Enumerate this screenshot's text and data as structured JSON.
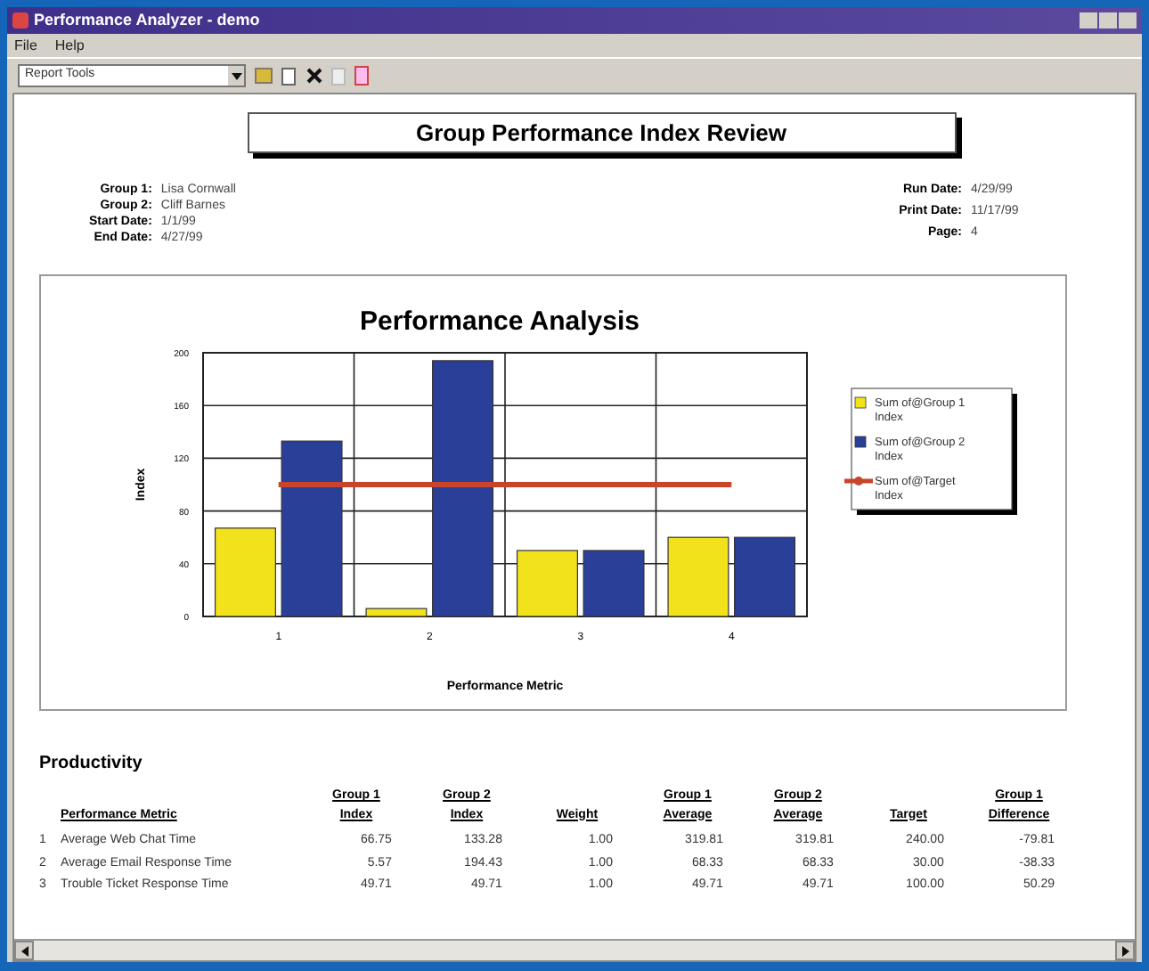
{
  "window": {
    "title": "Performance Analyzer - demo"
  },
  "menu": [
    "File",
    "Help"
  ],
  "toolbar": {
    "report_select": "Report Tools"
  },
  "report": {
    "title": "Group Performance Index Review",
    "info_left": [
      {
        "label": "Group 1:",
        "value": "Lisa Cornwall"
      },
      {
        "label": "Group 2:",
        "value": "Cliff Barnes"
      },
      {
        "label": "Start Date:",
        "value": "1/1/99"
      },
      {
        "label": "End Date:",
        "value": "4/27/99"
      }
    ],
    "info_right": [
      {
        "label": "Run Date:",
        "value": "4/29/99"
      },
      {
        "label": "Print Date:",
        "value": "11/17/99"
      },
      {
        "label": "Page:",
        "value": "4"
      }
    ],
    "chart_data": {
      "type": "bar",
      "title": "Performance Analysis",
      "xlabel": "Performance Metric",
      "ylabel": "Index",
      "categories": [
        "1",
        "2",
        "3",
        "4"
      ],
      "series": [
        {
          "name": "Sum of@Group 1 Index",
          "color": "#f2e21c",
          "values": [
            67,
            6,
            50,
            60
          ]
        },
        {
          "name": "Sum of@Group 2 Index",
          "color": "#2a3f98",
          "values": [
            133,
            194,
            50,
            60
          ]
        },
        {
          "name": "Sum of@Target Index",
          "color": "#c8442a",
          "type": "line",
          "values": [
            100,
            100,
            100,
            100
          ]
        }
      ],
      "stacked": false,
      "grid": true,
      "legend": true,
      "ylim": [
        0,
        200
      ],
      "yticks": [
        0,
        40,
        80,
        120,
        160,
        200
      ]
    },
    "section": "Productivity",
    "columns": [
      {
        "label": "Performance Metric"
      },
      {
        "label": "Group 1 Index"
      },
      {
        "label": "Group 2 Index"
      },
      {
        "label": "Weight"
      },
      {
        "label": "Group 1 Average"
      },
      {
        "label": "Group 2 Average"
      },
      {
        "label": "Target"
      },
      {
        "label": "Group 1 Difference"
      }
    ],
    "rows": [
      {
        "number": "1",
        "cells": [
          "Average Web Chat Time",
          "66.75",
          "133.28",
          "1.00",
          "319.81",
          "319.81",
          "240.00",
          "-79.81"
        ]
      },
      {
        "number": "2",
        "cells": [
          "Average Email Response Time",
          "5.57",
          "194.43",
          "1.00",
          "68.33",
          "68.33",
          "30.00",
          "-38.33"
        ]
      },
      {
        "number": "3",
        "cells": [
          "Trouble Ticket Response Time",
          "49.71",
          "49.71",
          "1.00",
          "49.71",
          "49.71",
          "100.00",
          "50.29"
        ]
      }
    ]
  }
}
